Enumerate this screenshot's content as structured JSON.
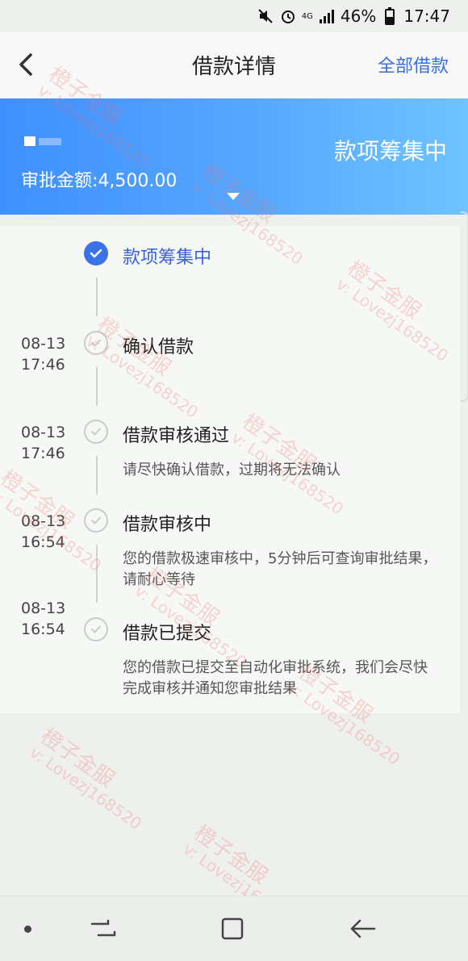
{
  "status_bar": {
    "battery": "46%",
    "time": "17:47",
    "network": "4G"
  },
  "header": {
    "title": "借款详情",
    "right_link": "全部借款"
  },
  "banner": {
    "amount_label": "审批金额:4,500.00",
    "status": "款项筹集中"
  },
  "timeline": [
    {
      "date": "",
      "time": "",
      "title": "款项筹集中",
      "desc": "",
      "active": true
    },
    {
      "date": "08-13",
      "time": "17:46",
      "title": "确认借款",
      "desc": ""
    },
    {
      "date": "08-13",
      "time": "17:46",
      "title": "借款审核通过",
      "desc": "请尽快确认借款，过期将无法确认"
    },
    {
      "date": "08-13",
      "time": "16:54",
      "title": "借款审核中",
      "desc": "您的借款极速审核中，5分钟后可查询审批结果，请耐心等待"
    },
    {
      "date": "08-13",
      "time": "16:54",
      "title": "借款已提交",
      "desc": "您的借款已提交至自动化审批系统，我们会尽快完成审核并通知您审批结果"
    }
  ],
  "watermark": {
    "line1": "橙子金服",
    "line2": "v: Lovezj168520"
  },
  "colors": {
    "accent": "#3a72e8",
    "banner_start": "#3f8fff",
    "banner_end": "#6fc3ff"
  },
  "nav_bar": {
    "icons": [
      "dot-icon",
      "recent-apps-icon",
      "home-icon",
      "back-icon"
    ]
  }
}
